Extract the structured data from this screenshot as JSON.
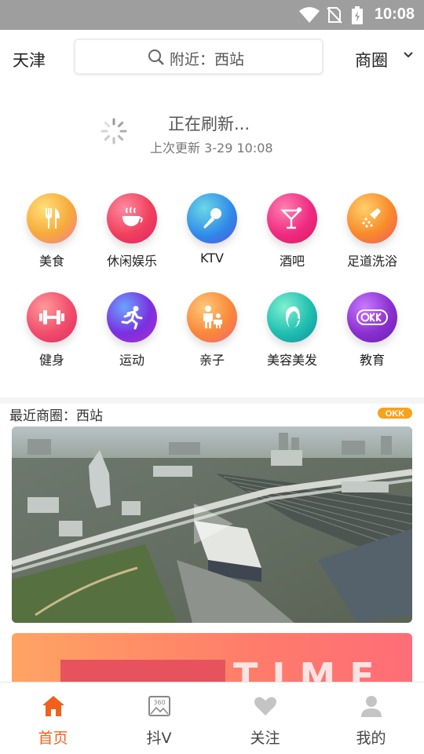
{
  "status_bar": {
    "time": "10:08"
  },
  "header": {
    "city": "天津",
    "search_placeholder": "附近：西站",
    "district": "商圈"
  },
  "refresh": {
    "title": "正在刷新...",
    "subtitle": "上次更新 3-29 10:08"
  },
  "categories": [
    {
      "label": "美食",
      "icon": "fork-knife-icon",
      "color": "#f6a93a"
    },
    {
      "label": "休闲娱乐",
      "icon": "coffee-cup-icon",
      "color": "#f0405c"
    },
    {
      "label": "KTV",
      "icon": "microphone-icon",
      "color": "#2e86e8"
    },
    {
      "label": "酒吧",
      "icon": "cocktail-icon",
      "color": "#ef2a82"
    },
    {
      "label": "足道洗浴",
      "icon": "shower-icon",
      "color": "#f88a2a"
    },
    {
      "label": "健身",
      "icon": "dumbbell-icon",
      "color": "#f04d6c"
    },
    {
      "label": "运动",
      "icon": "runner-icon",
      "color": "#7b2fe0"
    },
    {
      "label": "亲子",
      "icon": "parent-child-icon",
      "color": "#f9883a"
    },
    {
      "label": "美容美发",
      "icon": "woman-profile-icon",
      "color": "#1fbfb0"
    },
    {
      "label": "教育",
      "icon": "okk-badge-icon",
      "color": "#8a2fd0"
    }
  ],
  "recent": {
    "title": "最近商圈：西站",
    "logo_text": "OKK"
  },
  "banner2": {
    "text": "TIME"
  },
  "bottom_nav": [
    {
      "label": "首页",
      "icon": "home-icon",
      "active": true
    },
    {
      "label": "抖V",
      "icon": "panorama-360-icon",
      "active": false
    },
    {
      "label": "关注",
      "icon": "heart-icon",
      "active": false
    },
    {
      "label": "我的",
      "icon": "user-icon",
      "active": false
    }
  ],
  "colors": {
    "accent": "#f0611e",
    "status_bar": "#9e9e9e"
  }
}
